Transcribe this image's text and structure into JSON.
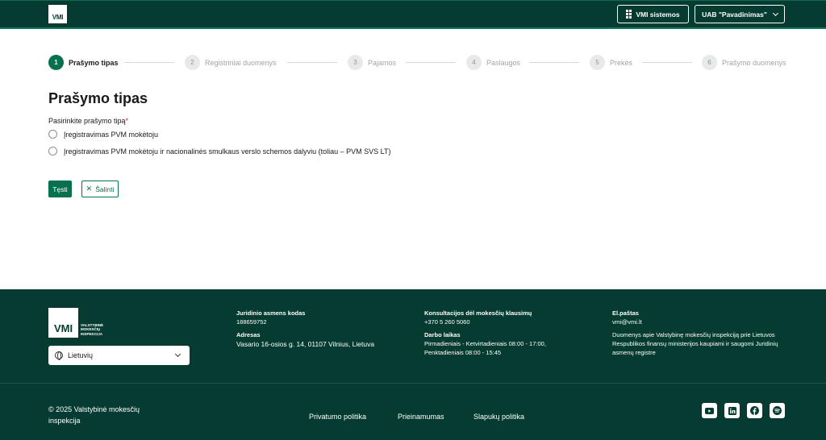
{
  "header": {
    "logo_text": "VMI",
    "systems_button": "VMI sistemos",
    "company_button": "UAB \"Pavadinimas\""
  },
  "stepper": [
    {
      "num": "1",
      "label": "Prašymo tipas"
    },
    {
      "num": "2",
      "label": "Registriniai duomenys"
    },
    {
      "num": "3",
      "label": "Pajamos"
    },
    {
      "num": "4",
      "label": "Paslaugos"
    },
    {
      "num": "5",
      "label": "Prekės"
    },
    {
      "num": "6",
      "label": "Prašymo duomenys"
    }
  ],
  "form": {
    "title": "Prašymo tipas",
    "question": "Pasirinkite prašymo tipą",
    "required_mark": "*",
    "options": [
      "Įregistravimas PVM mokėtoju",
      "Įregistravimas PVM mokėtoju ir nacionalinės smulkaus verslo schemos dalyviu (toliau – PVM SVS LT)"
    ],
    "next_button": "Tęsti",
    "clear_button": "Šalinti"
  },
  "footer": {
    "logo_text": "VMI",
    "logo_caption": [
      "VALSTYBINĖ",
      "MOKESČIŲ",
      "INSPEKCIJA"
    ],
    "language": "Lietuvių",
    "company_code_label": "Juridinio asmens kodas",
    "company_code": "188659752",
    "address_label": "Adresas",
    "address": "Vasario 16-osios g. 14, 01107 Vilnius, Lietuva",
    "consult_label": "Konsultacijos dėl mokesčių klausimų",
    "consult_phone": "+370 5 260 5060",
    "hours_label": "Darbo laikas",
    "hours_1": "Pirmadieniais - Ketvirtadieniais 08:00 - 17:00,",
    "hours_2": "Penktadieniais 08:00 - 15:45",
    "email_label": "El.paštas",
    "email": "vmi@vmi.lt",
    "data_note": "Duomenys apie Valstybinę mokesčių inspekciją prie Lietuvos Respublikos finansų ministerijos kaupiami ir saugomi Juridinių asmenų registre",
    "copyright": "© 2025 Valstybinė mokesčių inspekcija",
    "links": [
      "Privatumo politika",
      "Prieinamumas",
      "Slapukų politika"
    ],
    "social_icons": [
      "youtube-icon",
      "linkedin-icon",
      "facebook-icon",
      "spotify-icon"
    ]
  }
}
